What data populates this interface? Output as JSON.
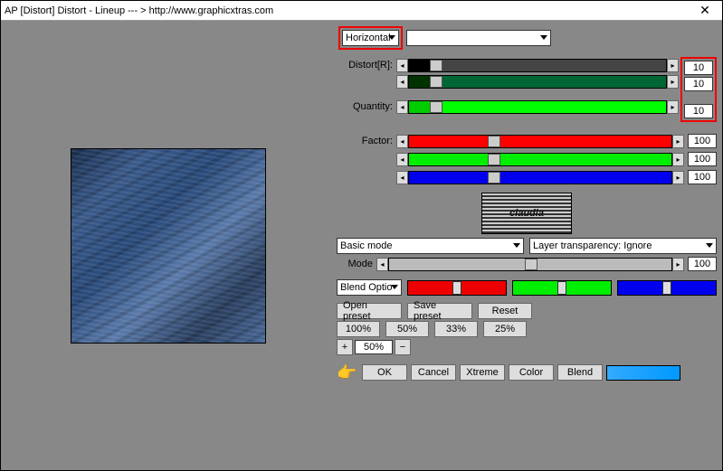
{
  "title": "AP [Distort]  Distort - Lineup   --- > http://www.graphicxtras.com",
  "direction": {
    "selected": "Horizontal"
  },
  "sliders": {
    "distort_label": "Distort[R]:",
    "distort_r": 10,
    "distort_g": 10,
    "quantity_label": "Quantity:",
    "quantity": 10,
    "factor_label": "Factor:",
    "factor_r": 100,
    "factor_g": 100,
    "factor_b": 100
  },
  "logo_text": "claudia",
  "mode_dropdown": "Basic mode",
  "layer_dropdown": "Layer transparency: Ignore",
  "mode_label": "Mode",
  "mode_value": 100,
  "blend_opt": "Blend Optio",
  "buttons": {
    "open_preset": "Open preset",
    "save_preset": "Save preset",
    "reset": "Reset",
    "p100": "100%",
    "p50": "50%",
    "p33": "33%",
    "p25": "25%",
    "zoom_plus": "+",
    "zoom_val": "50%",
    "zoom_minus": "−",
    "ok": "OK",
    "cancel": "Cancel",
    "xtreme": "Xtreme",
    "color": "Color",
    "blend": "Blend"
  },
  "arrows": {
    "l": "◂",
    "r": "▸"
  }
}
